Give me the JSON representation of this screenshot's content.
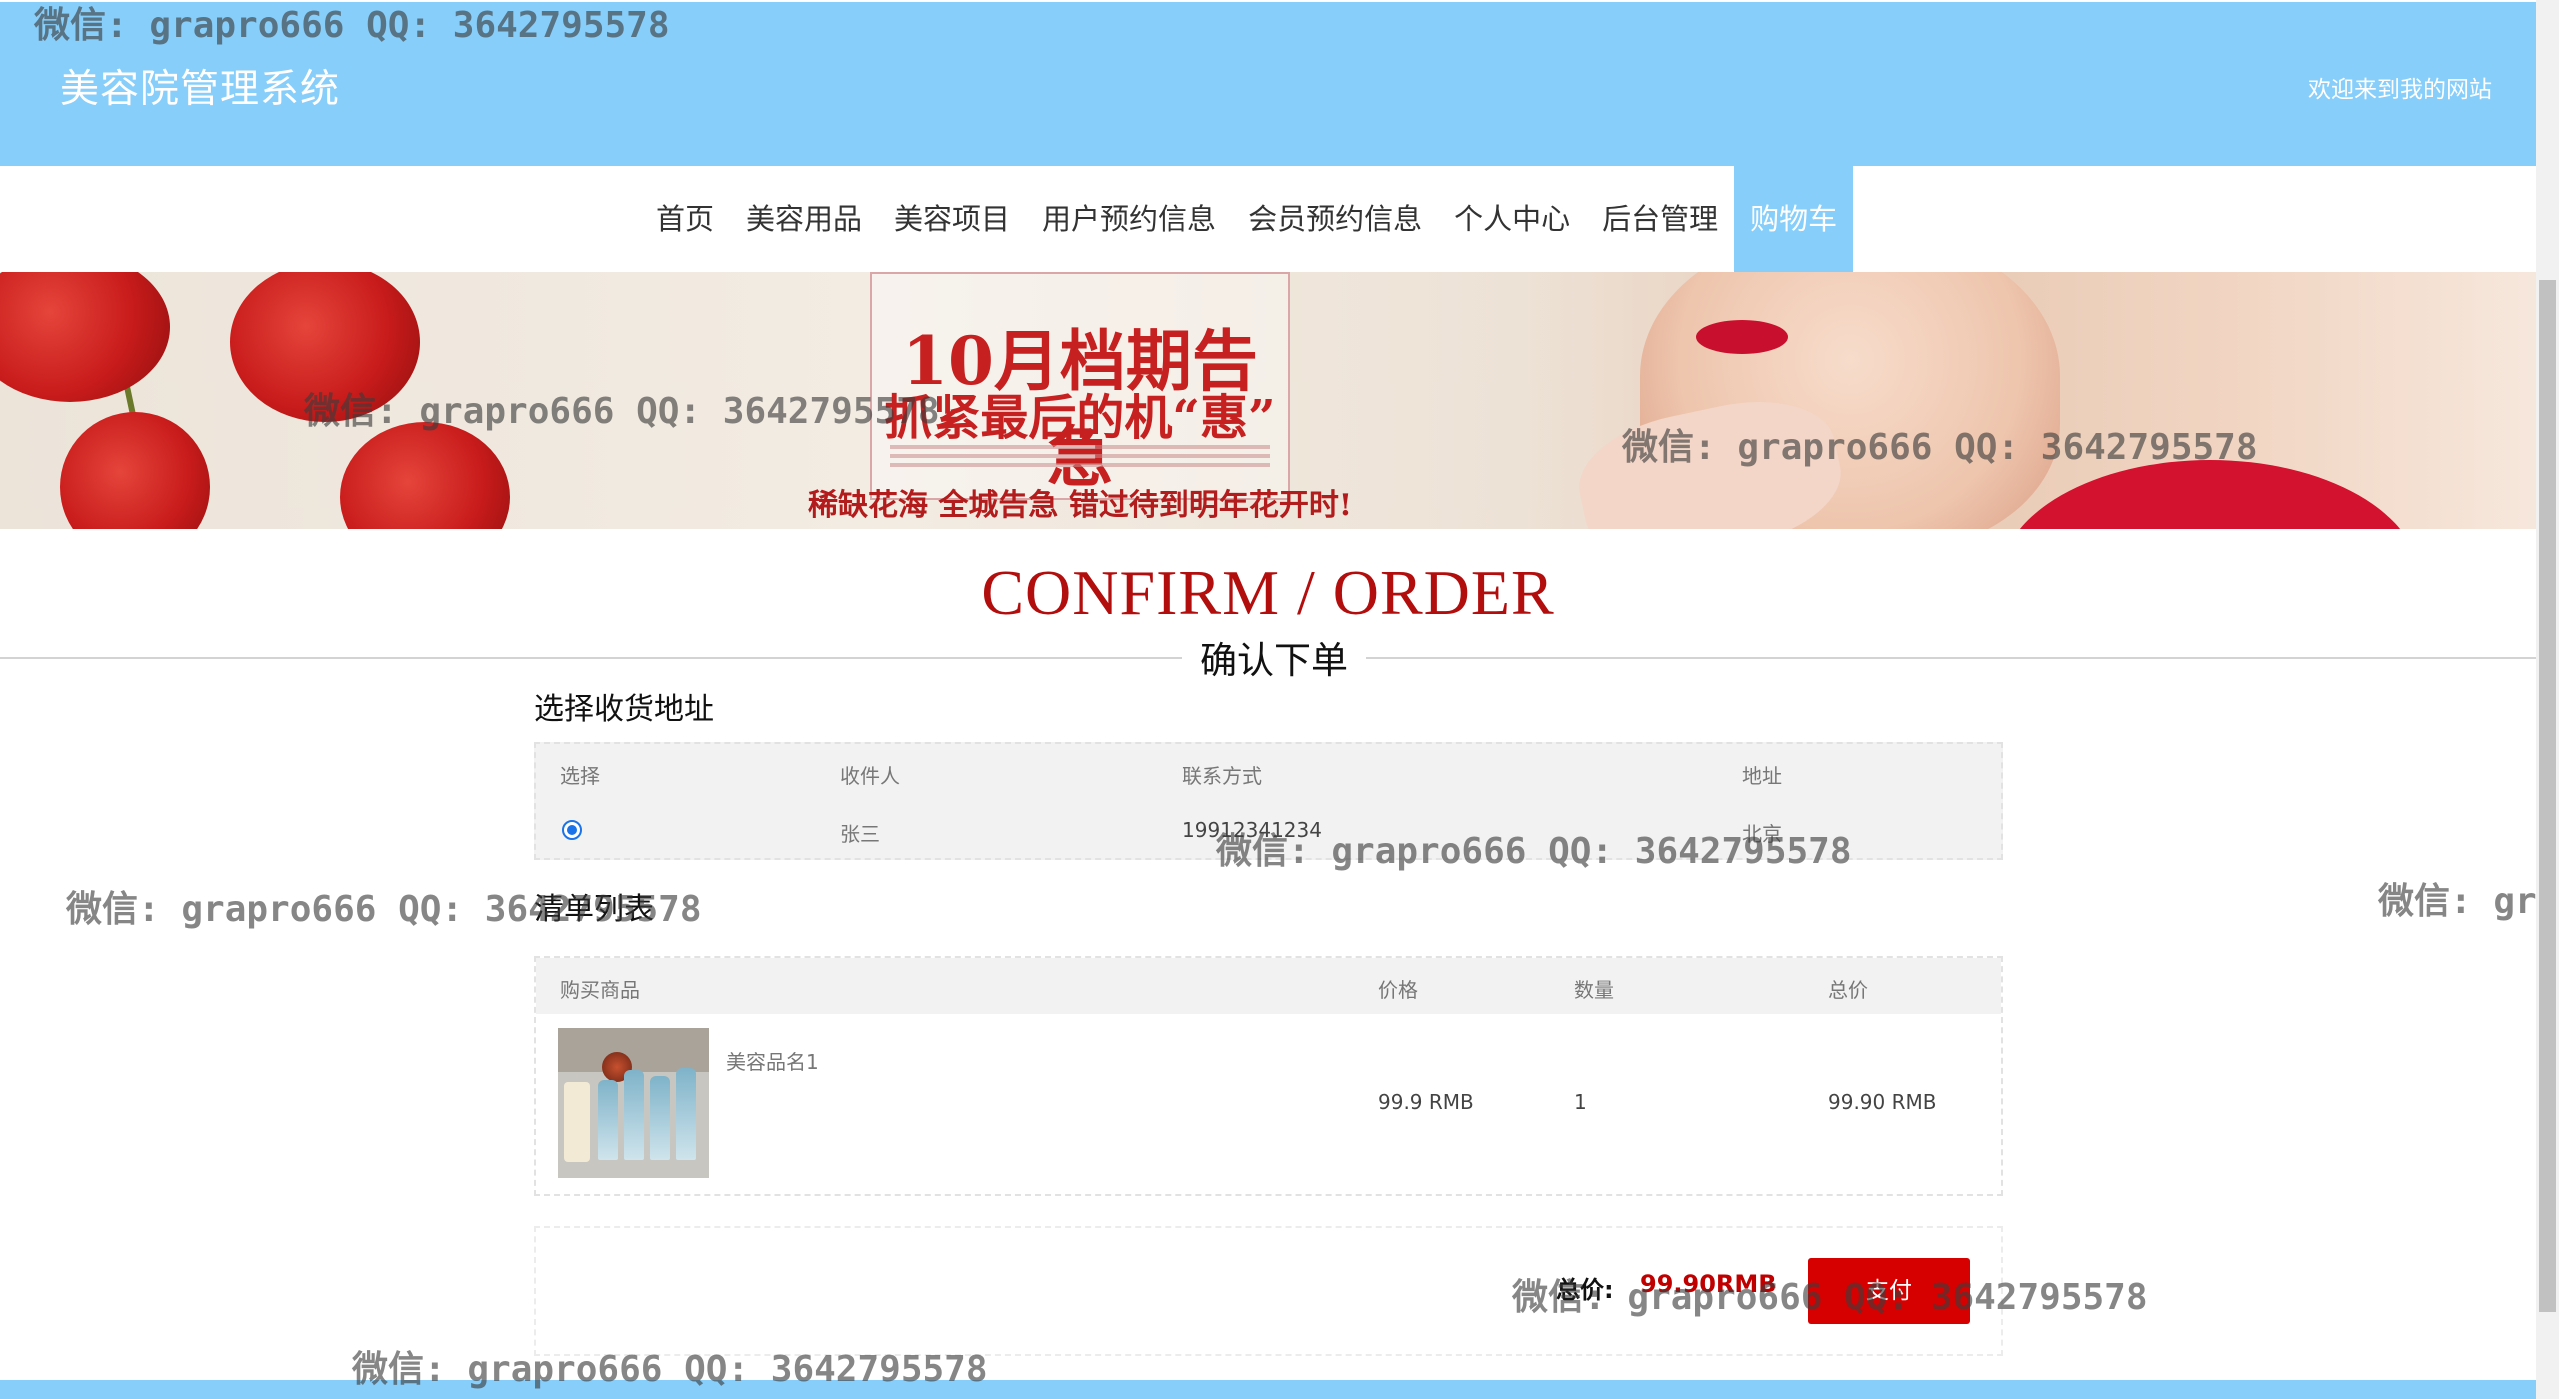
{
  "header": {
    "site_title": "美容院管理系统",
    "welcome": "欢迎来到我的网站"
  },
  "nav": {
    "items": [
      {
        "label": "首页",
        "active": false
      },
      {
        "label": "美容用品",
        "active": false
      },
      {
        "label": "美容项目",
        "active": false
      },
      {
        "label": "用户预约信息",
        "active": false
      },
      {
        "label": "会员预约信息",
        "active": false
      },
      {
        "label": "个人中心",
        "active": false
      },
      {
        "label": "后台管理",
        "active": false
      },
      {
        "label": "购物车",
        "active": true
      }
    ]
  },
  "banner": {
    "heading": "10月档期告急",
    "subheading": "抓紧最后的机“惠”",
    "slogan": "稀缺花海 全城告急 错过待到明年花开时!"
  },
  "page": {
    "title_en": "CONFIRM / ORDER",
    "title_cn": "确认下单"
  },
  "address_section": {
    "label": "选择收货地址",
    "columns": [
      "选择",
      "收件人",
      "联系方式",
      "地址"
    ],
    "rows": [
      {
        "selected": true,
        "recipient": "张三",
        "phone": "19912341234",
        "address": "北京"
      }
    ]
  },
  "order_section": {
    "label": "清单列表",
    "columns": [
      "购买商品",
      "价格",
      "数量",
      "总价"
    ],
    "items": [
      {
        "name": "美容品名1",
        "price": "99.9 RMB",
        "quantity": "1",
        "subtotal": "99.90 RMB"
      }
    ]
  },
  "summary": {
    "total_label": "总价:",
    "total_value": "99.90RMB",
    "pay_label": "支付"
  },
  "watermark": {
    "text": "微信: grapro666 QQ: 3642795578",
    "partial": "微信: gra"
  },
  "colors": {
    "header_bg": "#87cefa",
    "accent_red": "#c00000",
    "pay_button": "#d70000"
  }
}
